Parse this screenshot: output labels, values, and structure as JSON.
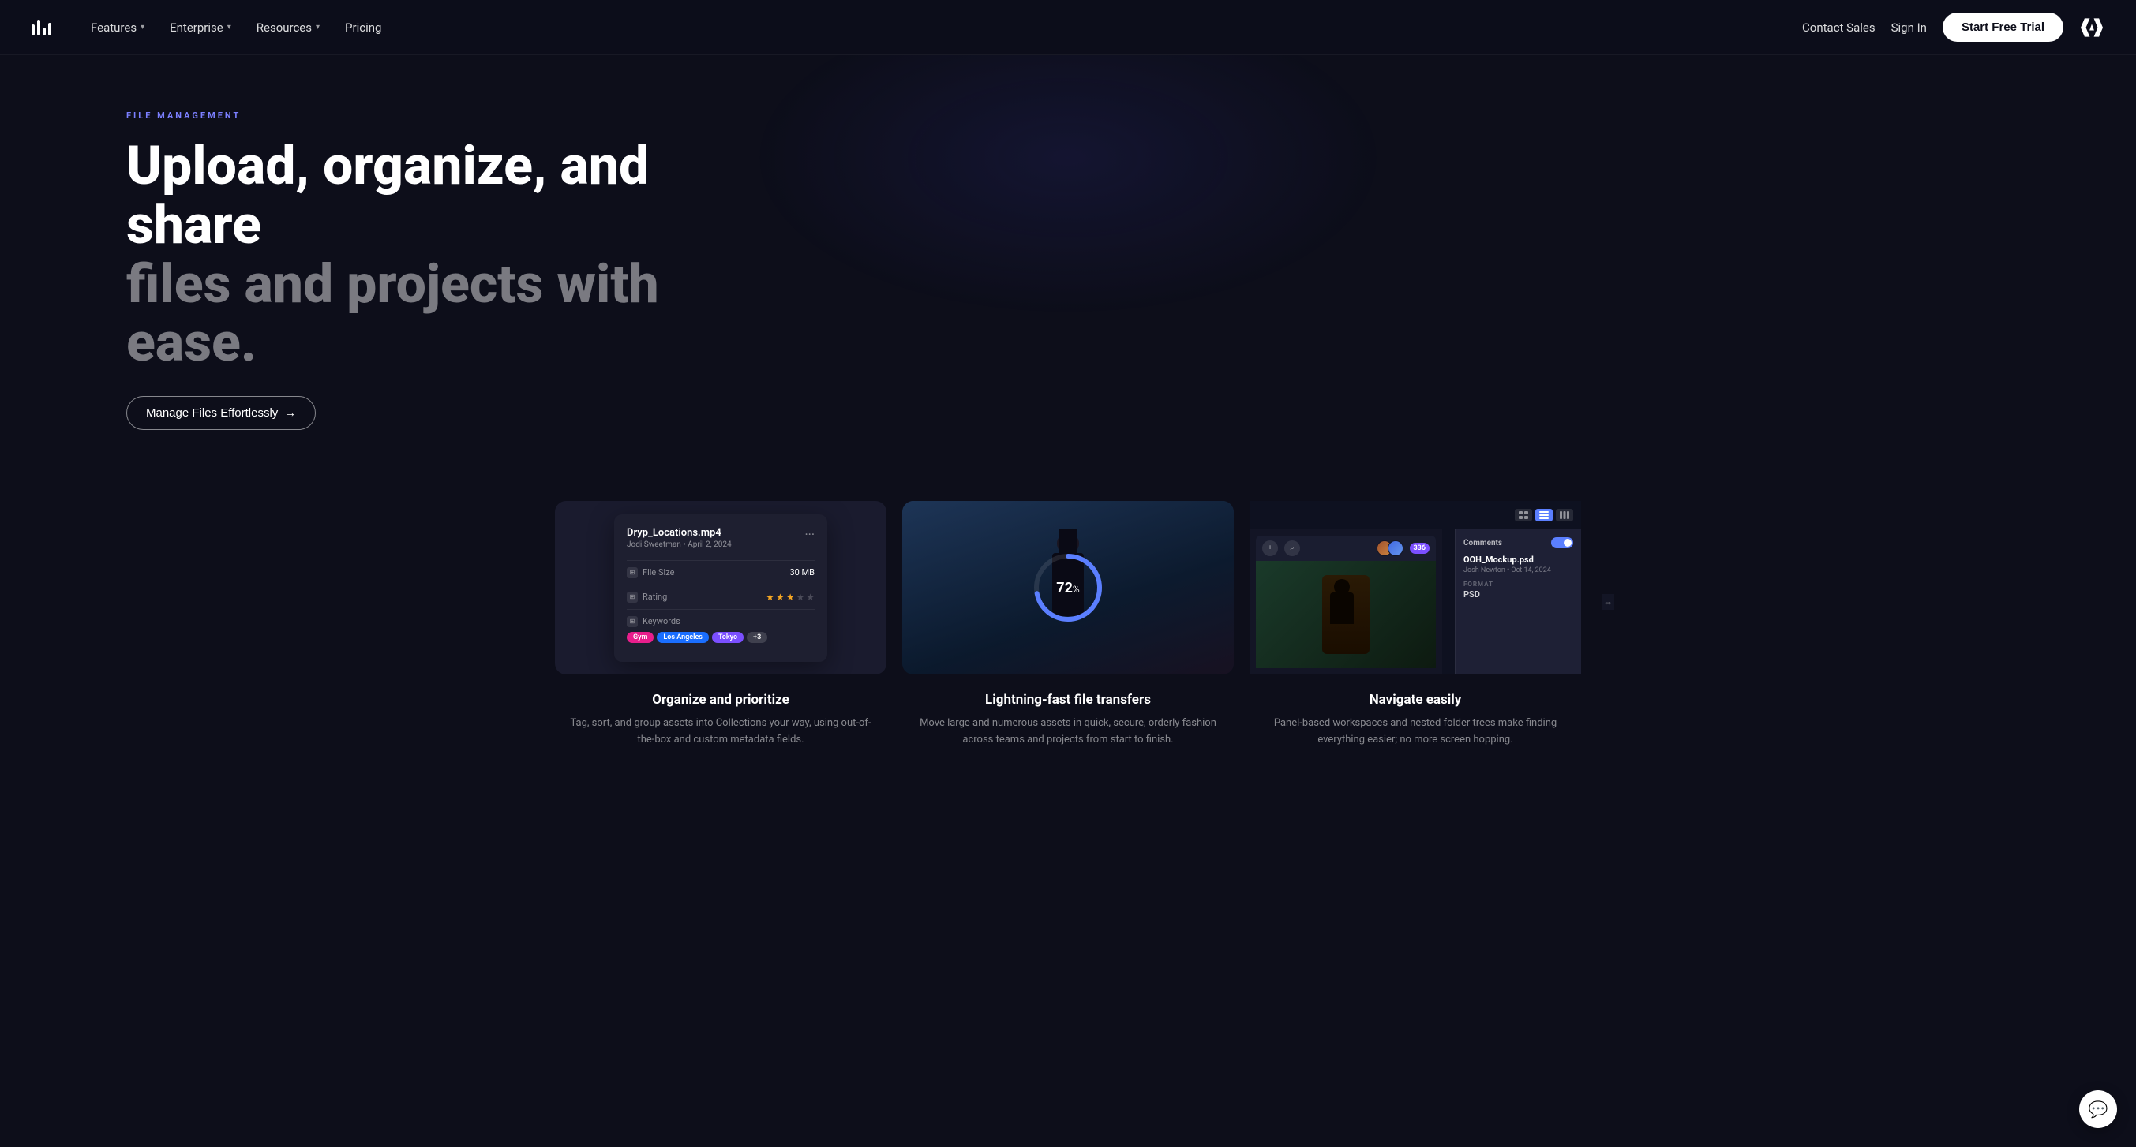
{
  "nav": {
    "features_label": "Features",
    "enterprise_label": "Enterprise",
    "resources_label": "Resources",
    "pricing_label": "Pricing",
    "contact_sales_label": "Contact Sales",
    "sign_in_label": "Sign In",
    "trial_label": "Start Free Trial"
  },
  "hero": {
    "category_label": "FILE MANAGEMENT",
    "title_line1": "Upload, organize, and share",
    "title_line2": "files and projects with ease.",
    "cta_label": "Manage Files Effortlessly",
    "cta_arrow": "→"
  },
  "cards": [
    {
      "id": "organize",
      "title": "Organize and prioritize",
      "description": "Tag, sort, and group assets into Collections your way, using out-of-the-box and custom metadata fields.",
      "mockup": {
        "filename": "Dryp_Locations.mp4",
        "author": "Jodi Sweetman",
        "date": "April 2, 2024",
        "file_size_label": "File Size",
        "file_size_value": "30 MB",
        "rating_label": "Rating",
        "keywords_label": "Keywords",
        "tags": [
          "Gym",
          "Los Angeles",
          "Tokyo",
          "+3"
        ]
      }
    },
    {
      "id": "transfer",
      "title": "Lightning-fast file transfers",
      "description": "Move large and numerous assets in quick, secure, orderly fashion across teams and projects from start to finish.",
      "progress": 72
    },
    {
      "id": "navigate",
      "title": "Navigate easily",
      "description": "Panel-based workspaces and nested folder trees make finding everything easier; no more screen hopping.",
      "mockup": {
        "filename": "OOH_Mockup.psd",
        "author": "Josh Newton",
        "date": "Oct 14, 2024",
        "format_label": "FORMAT",
        "format_value": "PSD",
        "comments_label": "Comments",
        "badge_count": "336"
      }
    }
  ]
}
